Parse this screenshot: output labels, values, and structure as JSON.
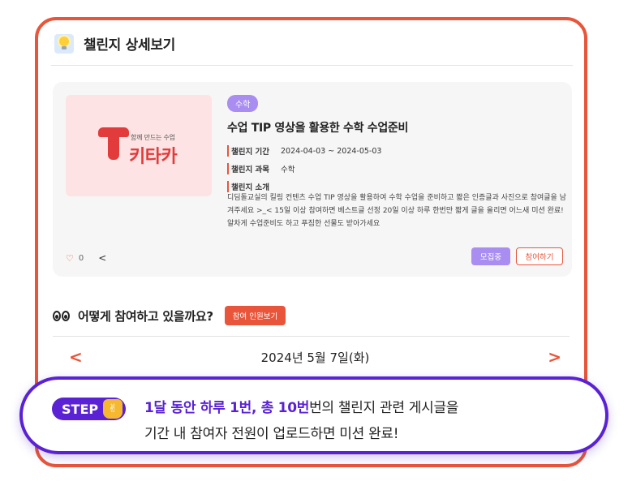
{
  "header": {
    "title": "챌린지 상세보기",
    "icon": "lightbulb-icon"
  },
  "card": {
    "subject_badge": "수학",
    "title": "수업 TIP 영상을 활용한 수학 수업준비",
    "thumbnail": {
      "logo_small": "함께 만드는 수업",
      "logo_big": "키타카"
    },
    "period_label": "챌린지 기간",
    "period_value": "2024-04-03 ~ 2024-05-03",
    "subject_label": "챌린지 과목",
    "subject_value": "수학",
    "intro_label": "챌린지 소개",
    "intro_text": "디딤돌교실의 킬링 컨텐츠 수업 TIP 영상을 활용하여 수학 수업을 준비하고 짧은 인증글과 사진으로 참여글을 남겨주세요 >_< 15일 이상 참여하면 베스트글 선정 20일 이상 하루 한번만 짧게 글을 올리면 어느새 미션 완료! 알차게 수업준비도 하고 푸짐한 선물도 받아가세요",
    "like_count": "0",
    "status_button": "모집중",
    "join_button": "참여하기"
  },
  "participate": {
    "title": "어떻게 참여하고 있을까요?",
    "members_button": "참여 인원보기"
  },
  "date_nav": {
    "prev": "<",
    "date": "2024년 5월 7일(화)",
    "next": ">"
  },
  "step": {
    "badge": "STEP",
    "line1_highlight": "1달 동안 하루 1번, 총 10번",
    "line1_rest": "번의 챌린지 관련 게시글을",
    "line2": "기간 내 참여자 전원이 업로드하면 미션 완료!"
  },
  "colors": {
    "accent": "#e8553a",
    "purple": "#a98df0",
    "step_purple": "#5a22d4",
    "brand_red": "#e23b3b"
  }
}
